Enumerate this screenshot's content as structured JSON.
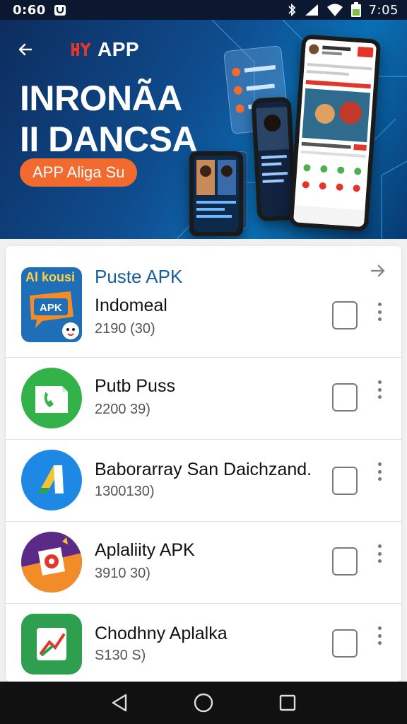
{
  "status_bar": {
    "time_left": "0:60",
    "time_right": "7:05",
    "icons": [
      "app-notification-icon",
      "bluetooth-icon",
      "signal-icon",
      "wifi-icon",
      "battery-icon"
    ]
  },
  "header": {
    "back_icon": "back-arrow-icon",
    "brand_name": "APP",
    "title_line1": "INRONÃA",
    "title_line2": "II DANCSA",
    "badge_label": "APP Aliga Su"
  },
  "list": {
    "section_title": "Puste APK",
    "header_arrow_icon": "arrow-right-icon",
    "apps": [
      {
        "name": "Indomeal",
        "meta": "2190  (30)",
        "icon": "apk-app-icon"
      },
      {
        "name": "Putb Puss",
        "meta": "2200  39)",
        "icon": "phone-app-icon"
      },
      {
        "name": "Baborarray San Daichzand.",
        "meta": "1300130)",
        "icon": "tilt-app-icon"
      },
      {
        "name": "Aplaliity APK",
        "meta": "3910  30)",
        "icon": "camera-app-icon"
      },
      {
        "name": "Chodhny Aplalka",
        "meta": "S130  S)",
        "icon": "chart-app-icon"
      }
    ]
  },
  "nav_bar": {
    "back": "nav-back-icon",
    "home": "nav-home-icon",
    "recents": "nav-recents-icon"
  },
  "colors": {
    "hero_blue": "#0f4d8f",
    "accent_orange": "#f26a2e",
    "section_title_blue": "#1a5d9c",
    "brand_red": "#e2362a"
  }
}
